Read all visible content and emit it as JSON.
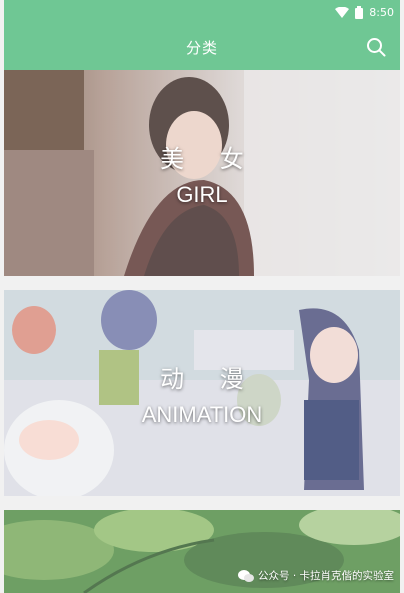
{
  "status_bar": {
    "time": "8:50",
    "icons": [
      "wifi-icon",
      "battery-icon"
    ]
  },
  "app_bar": {
    "title": "分类",
    "search_icon": "search-icon"
  },
  "categories": [
    {
      "title_cn": "美 女",
      "title_en": "GIRL"
    },
    {
      "title_cn": "动 漫",
      "title_en": "ANIMATION"
    },
    {
      "title_cn": "⚪⚪⚪",
      "title_en": ""
    }
  ],
  "watermark": {
    "text": "公众号 · 卡拉肖克偕的实验室"
  },
  "colors": {
    "primary": "#6fc794",
    "text_on_primary": "#ffffff"
  }
}
